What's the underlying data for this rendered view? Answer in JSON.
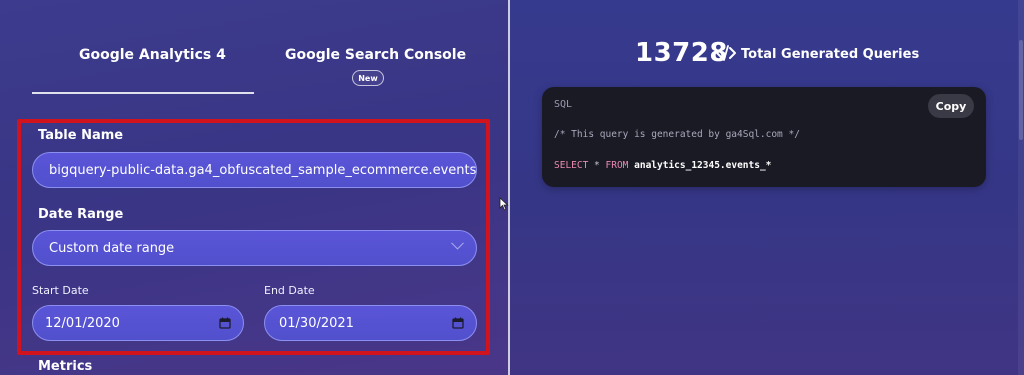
{
  "tabs": {
    "ga4": "Google Analytics 4",
    "gsc": "Google Search Console",
    "new_badge": "New"
  },
  "form": {
    "table_name_label": "Table Name",
    "table_name_value": "bigquery-public-data.ga4_obfuscated_sample_ecommerce.events_",
    "date_range_label": "Date Range",
    "date_range_value": "Custom date range",
    "start_date_label": "Start Date",
    "start_date_value": "12/01/2020",
    "end_date_label": "End Date",
    "end_date_value": "01/30/2021",
    "metrics_label": "Metrics"
  },
  "stats": {
    "count": "13728",
    "label": "Total Generated Queries"
  },
  "code": {
    "language": "SQL",
    "copy_label": "Copy",
    "comment": "/* This query is generated by ga4Sql.com */",
    "select_kw": "SELECT",
    "star": " * ",
    "from_kw": "FROM",
    "table": "analytics_12345.events_*"
  },
  "colors": {
    "accent": "#5a55d8",
    "highlight": "#d0131c",
    "code_bg": "#1a1a24"
  },
  "icons": [
    "code-brackets-icon",
    "calendar-icon",
    "chevron-down-icon",
    "mouse-cursor-icon"
  ]
}
